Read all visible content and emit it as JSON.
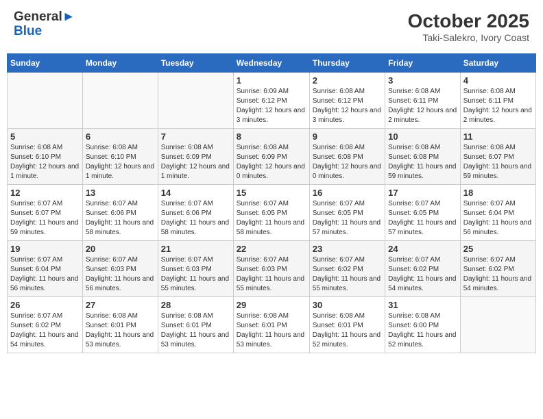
{
  "header": {
    "logo_general": "General",
    "logo_blue": "Blue",
    "title": "October 2025",
    "subtitle": "Taki-Salekro, Ivory Coast"
  },
  "calendar": {
    "weekdays": [
      "Sunday",
      "Monday",
      "Tuesday",
      "Wednesday",
      "Thursday",
      "Friday",
      "Saturday"
    ],
    "weeks": [
      [
        {
          "day": "",
          "info": ""
        },
        {
          "day": "",
          "info": ""
        },
        {
          "day": "",
          "info": ""
        },
        {
          "day": "1",
          "info": "Sunrise: 6:09 AM\nSunset: 6:12 PM\nDaylight: 12 hours and 3 minutes."
        },
        {
          "day": "2",
          "info": "Sunrise: 6:08 AM\nSunset: 6:12 PM\nDaylight: 12 hours and 3 minutes."
        },
        {
          "day": "3",
          "info": "Sunrise: 6:08 AM\nSunset: 6:11 PM\nDaylight: 12 hours and 2 minutes."
        },
        {
          "day": "4",
          "info": "Sunrise: 6:08 AM\nSunset: 6:11 PM\nDaylight: 12 hours and 2 minutes."
        }
      ],
      [
        {
          "day": "5",
          "info": "Sunrise: 6:08 AM\nSunset: 6:10 PM\nDaylight: 12 hours and 1 minute."
        },
        {
          "day": "6",
          "info": "Sunrise: 6:08 AM\nSunset: 6:10 PM\nDaylight: 12 hours and 1 minute."
        },
        {
          "day": "7",
          "info": "Sunrise: 6:08 AM\nSunset: 6:09 PM\nDaylight: 12 hours and 1 minute."
        },
        {
          "day": "8",
          "info": "Sunrise: 6:08 AM\nSunset: 6:09 PM\nDaylight: 12 hours and 0 minutes."
        },
        {
          "day": "9",
          "info": "Sunrise: 6:08 AM\nSunset: 6:08 PM\nDaylight: 12 hours and 0 minutes."
        },
        {
          "day": "10",
          "info": "Sunrise: 6:08 AM\nSunset: 6:08 PM\nDaylight: 11 hours and 59 minutes."
        },
        {
          "day": "11",
          "info": "Sunrise: 6:08 AM\nSunset: 6:07 PM\nDaylight: 11 hours and 59 minutes."
        }
      ],
      [
        {
          "day": "12",
          "info": "Sunrise: 6:07 AM\nSunset: 6:07 PM\nDaylight: 11 hours and 59 minutes."
        },
        {
          "day": "13",
          "info": "Sunrise: 6:07 AM\nSunset: 6:06 PM\nDaylight: 11 hours and 58 minutes."
        },
        {
          "day": "14",
          "info": "Sunrise: 6:07 AM\nSunset: 6:06 PM\nDaylight: 11 hours and 58 minutes."
        },
        {
          "day": "15",
          "info": "Sunrise: 6:07 AM\nSunset: 6:05 PM\nDaylight: 11 hours and 58 minutes."
        },
        {
          "day": "16",
          "info": "Sunrise: 6:07 AM\nSunset: 6:05 PM\nDaylight: 11 hours and 57 minutes."
        },
        {
          "day": "17",
          "info": "Sunrise: 6:07 AM\nSunset: 6:05 PM\nDaylight: 11 hours and 57 minutes."
        },
        {
          "day": "18",
          "info": "Sunrise: 6:07 AM\nSunset: 6:04 PM\nDaylight: 11 hours and 56 minutes."
        }
      ],
      [
        {
          "day": "19",
          "info": "Sunrise: 6:07 AM\nSunset: 6:04 PM\nDaylight: 11 hours and 56 minutes."
        },
        {
          "day": "20",
          "info": "Sunrise: 6:07 AM\nSunset: 6:03 PM\nDaylight: 11 hours and 56 minutes."
        },
        {
          "day": "21",
          "info": "Sunrise: 6:07 AM\nSunset: 6:03 PM\nDaylight: 11 hours and 55 minutes."
        },
        {
          "day": "22",
          "info": "Sunrise: 6:07 AM\nSunset: 6:03 PM\nDaylight: 11 hours and 55 minutes."
        },
        {
          "day": "23",
          "info": "Sunrise: 6:07 AM\nSunset: 6:02 PM\nDaylight: 11 hours and 55 minutes."
        },
        {
          "day": "24",
          "info": "Sunrise: 6:07 AM\nSunset: 6:02 PM\nDaylight: 11 hours and 54 minutes."
        },
        {
          "day": "25",
          "info": "Sunrise: 6:07 AM\nSunset: 6:02 PM\nDaylight: 11 hours and 54 minutes."
        }
      ],
      [
        {
          "day": "26",
          "info": "Sunrise: 6:07 AM\nSunset: 6:02 PM\nDaylight: 11 hours and 54 minutes."
        },
        {
          "day": "27",
          "info": "Sunrise: 6:08 AM\nSunset: 6:01 PM\nDaylight: 11 hours and 53 minutes."
        },
        {
          "day": "28",
          "info": "Sunrise: 6:08 AM\nSunset: 6:01 PM\nDaylight: 11 hours and 53 minutes."
        },
        {
          "day": "29",
          "info": "Sunrise: 6:08 AM\nSunset: 6:01 PM\nDaylight: 11 hours and 53 minutes."
        },
        {
          "day": "30",
          "info": "Sunrise: 6:08 AM\nSunset: 6:01 PM\nDaylight: 11 hours and 52 minutes."
        },
        {
          "day": "31",
          "info": "Sunrise: 6:08 AM\nSunset: 6:00 PM\nDaylight: 11 hours and 52 minutes."
        },
        {
          "day": "",
          "info": ""
        }
      ]
    ]
  }
}
